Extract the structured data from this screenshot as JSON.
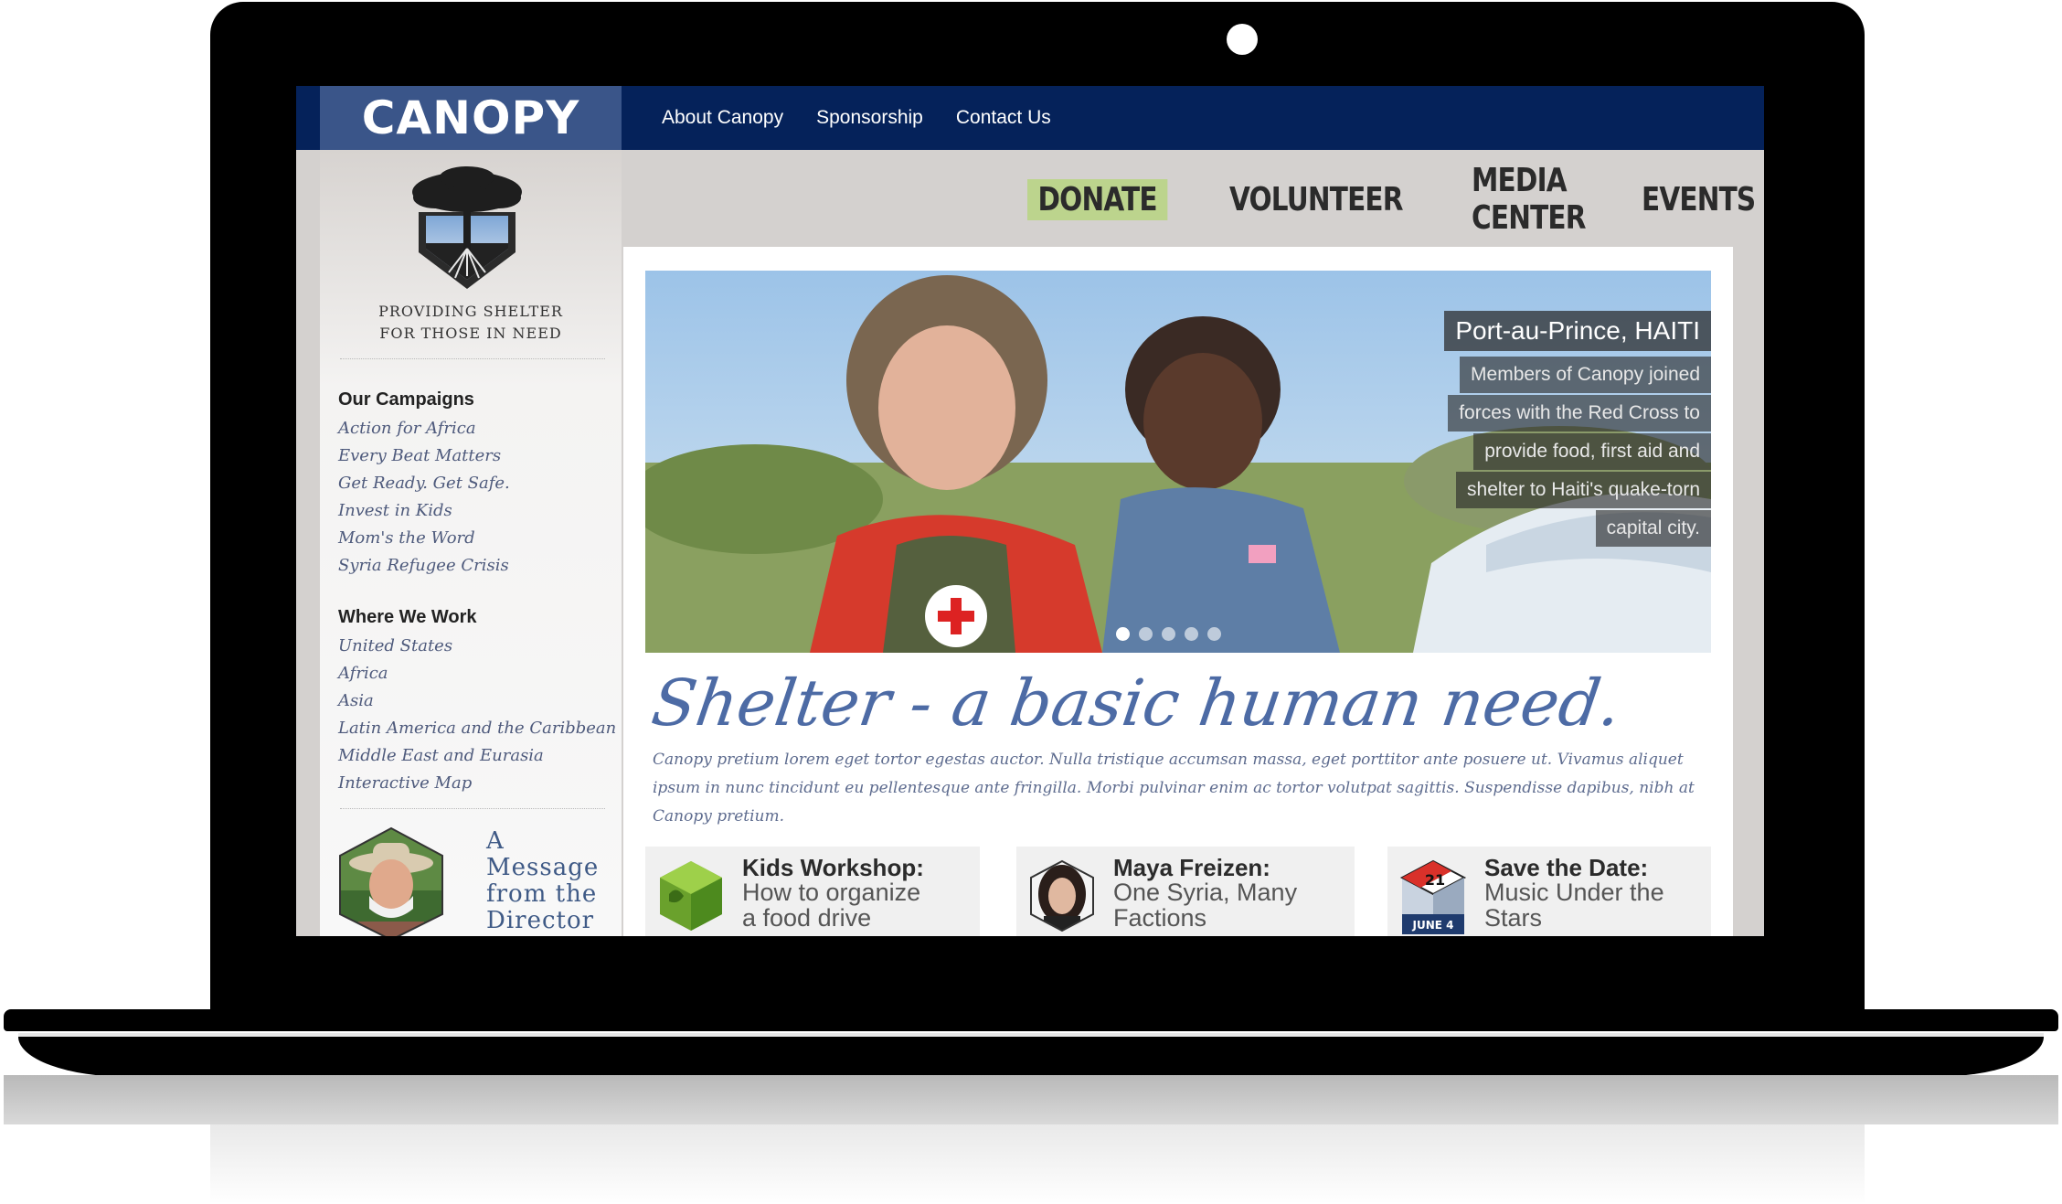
{
  "site": {
    "brand": "CANOPY",
    "tagline_line1": "PROVIDING SHELTER",
    "tagline_line2": "FOR THOSE IN NEED"
  },
  "top_nav": [
    "About Canopy",
    "Sponsorship",
    "Contact Us"
  ],
  "main_nav": [
    "DONATE",
    "VOLUNTEER",
    "MEDIA CENTER",
    "EVENTS"
  ],
  "sidebar": {
    "campaigns_heading": "Our Campaigns",
    "campaigns": [
      "Action for Africa",
      "Every Beat Matters",
      "Get Ready. Get Safe.",
      "Invest in Kids",
      "Mom's the Word",
      "Syria Refugee Crisis"
    ],
    "where_heading": "Where We Work",
    "regions": [
      "United States",
      "Africa",
      "Asia",
      "Latin America and the Caribbean",
      "Middle East and Eurasia",
      "Interactive Map"
    ],
    "director_line1": "A Message",
    "director_line2": "from the",
    "director_line3": "Director"
  },
  "hero": {
    "title": "Port-au-Prince, HAITI",
    "lines": [
      "Members of Canopy joined",
      "forces with the Red Cross to",
      "provide food, first aid and",
      "shelter to Haiti's quake-torn",
      "capital city."
    ],
    "slide_count": 5,
    "active_slide": 1
  },
  "headline": "Shelter - a basic human need.",
  "intro": "Canopy pretium lorem eget tortor egestas auctor. Nulla tristique accumsan massa, eget porttitor ante posuere ut. Vivamus aliquet ipsum in nunc tincidunt eu pellentesque ante fringilla. Morbi pulvinar enim ac tortor volutpat sagittis. Suspendisse dapibus, nibh at Canopy pretium.",
  "cards": [
    {
      "title": "Kids Workshop:",
      "sub1": "How to organize",
      "sub2": "a food drive"
    },
    {
      "title": "Maya Freizen:",
      "sub1": "One Syria, Many",
      "sub2": "Factions"
    },
    {
      "title": "Save the Date:",
      "sub1": "Music Under the",
      "sub2": "Stars",
      "date": "JUNE 4",
      "day": "21"
    }
  ],
  "colors": {
    "topbar": "#05225a",
    "brand_box": "#3a5589",
    "donate_bg": "#bcd48d",
    "link_text": "#4e5a7c",
    "headline": "#4d6ba5"
  }
}
